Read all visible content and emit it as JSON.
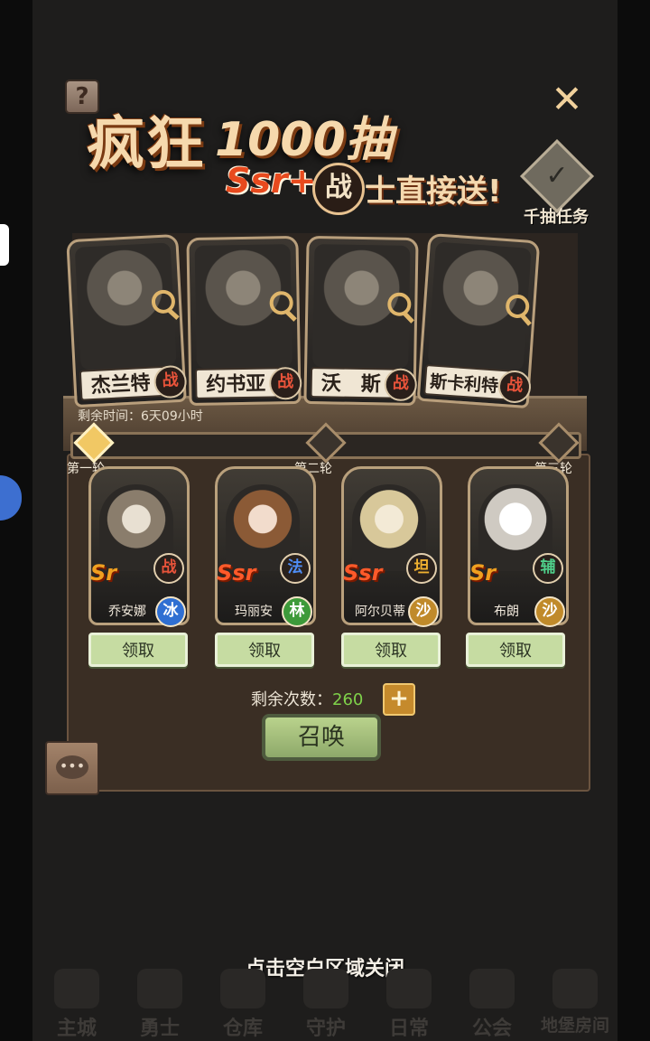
{
  "event": {
    "title_main": "疯狂",
    "title_count": "1000抽",
    "sub_tag": "Ssr+",
    "sub_badge": "战",
    "sub_text": "士直接送!",
    "help_icon": "?",
    "close_icon": "✕"
  },
  "task": {
    "label": "千抽任务",
    "icon": "checkbox-icon"
  },
  "featured": [
    {
      "name": "杰兰特",
      "cls": "战"
    },
    {
      "name": "约书亚",
      "cls": "战"
    },
    {
      "name": "沃　斯",
      "cls": "战"
    },
    {
      "name": "斯卡利特",
      "cls": "战"
    }
  ],
  "remaining_time": "剩余时间：6天09小时",
  "progress": {
    "fraction": 0.0,
    "rounds": [
      "第一轮",
      "第二轮",
      "第三轮"
    ]
  },
  "rewards": [
    {
      "name": "乔安娜",
      "rarity": "Sr",
      "cls": "战",
      "elem": "冰",
      "claim": "领取"
    },
    {
      "name": "玛丽安",
      "rarity": "Ssr",
      "cls": "法",
      "elem": "林",
      "claim": "领取"
    },
    {
      "name": "阿尔贝蒂",
      "rarity": "Ssr",
      "cls": "坦",
      "elem": "沙",
      "claim": "领取"
    },
    {
      "name": "布朗",
      "rarity": "Sr",
      "cls": "辅",
      "elem": "沙",
      "claim": "领取"
    }
  ],
  "summon": {
    "count_label": "剩余次数：",
    "count": "260",
    "plus": "+",
    "button": "召唤"
  },
  "hint": "点击空白区域关闭",
  "nav": [
    "主城",
    "勇士",
    "仓库",
    "守护",
    "日常",
    "公会",
    "地堡房间"
  ],
  "colors": {
    "accent": "#f6d9ad",
    "claim_bg": "#c6dca2",
    "count_green": "#7fd24a",
    "ssr_red": "#e84a1e"
  }
}
